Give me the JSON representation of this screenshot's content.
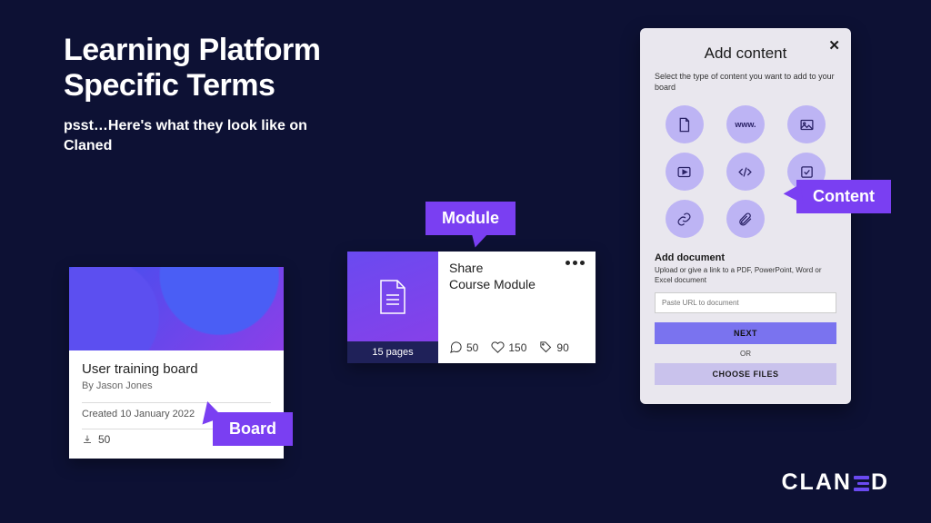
{
  "headline": "Learning Platform\nSpecific Terms",
  "subhead": "psst…Here's what they look like on Claned",
  "callouts": {
    "board": "Board",
    "module": "Module",
    "content": "Content"
  },
  "board": {
    "title": "User training board",
    "author": "By Jason Jones",
    "created": "Created 10 January 2022",
    "downloads": "50"
  },
  "module": {
    "title": "Share\nCourse Module",
    "pages": "15 pages",
    "comments": "50",
    "likes": "150",
    "tags": "90"
  },
  "content_modal": {
    "title": "Add content",
    "description": "Select the type of content you want to add to your board",
    "types": {
      "www": "www."
    },
    "add_doc_title": "Add document",
    "add_doc_desc": "Upload or give a link to a PDF, PowerPoint, Word or Excel document",
    "url_placeholder": "Paste URL to document",
    "next": "NEXT",
    "or": "OR",
    "choose": "CHOOSE FILES"
  },
  "brand": {
    "pre": "CLAN",
    "post": "D"
  }
}
